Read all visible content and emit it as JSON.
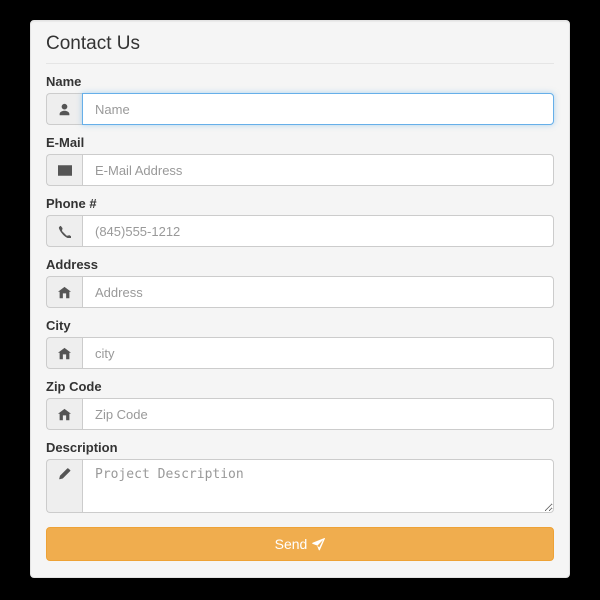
{
  "panel": {
    "title": "Contact Us"
  },
  "fields": {
    "name": {
      "label": "Name",
      "placeholder": "Name",
      "value": ""
    },
    "email": {
      "label": "E-Mail",
      "placeholder": "E-Mail Address",
      "value": ""
    },
    "phone": {
      "label": "Phone #",
      "placeholder": "(845)555-1212",
      "value": ""
    },
    "address": {
      "label": "Address",
      "placeholder": "Address",
      "value": ""
    },
    "city": {
      "label": "City",
      "placeholder": "city",
      "value": ""
    },
    "zip": {
      "label": "Zip Code",
      "placeholder": "Zip Code",
      "value": ""
    },
    "description": {
      "label": "Description",
      "placeholder": "Project Description",
      "value": ""
    }
  },
  "button": {
    "send": "Send"
  },
  "icons": {
    "user": "user-icon",
    "envelope": "envelope-icon",
    "phone": "phone-icon",
    "home": "home-icon",
    "pencil": "pencil-icon",
    "paper_plane": "paper-plane-icon"
  },
  "colors": {
    "panel_bg": "#f5f5f5",
    "addon_bg": "#eeeeee",
    "border": "#cccccc",
    "focus_border": "#66afe9",
    "button_bg": "#f0ad4e",
    "button_border": "#eea236",
    "text": "#333333",
    "placeholder": "#999999"
  }
}
